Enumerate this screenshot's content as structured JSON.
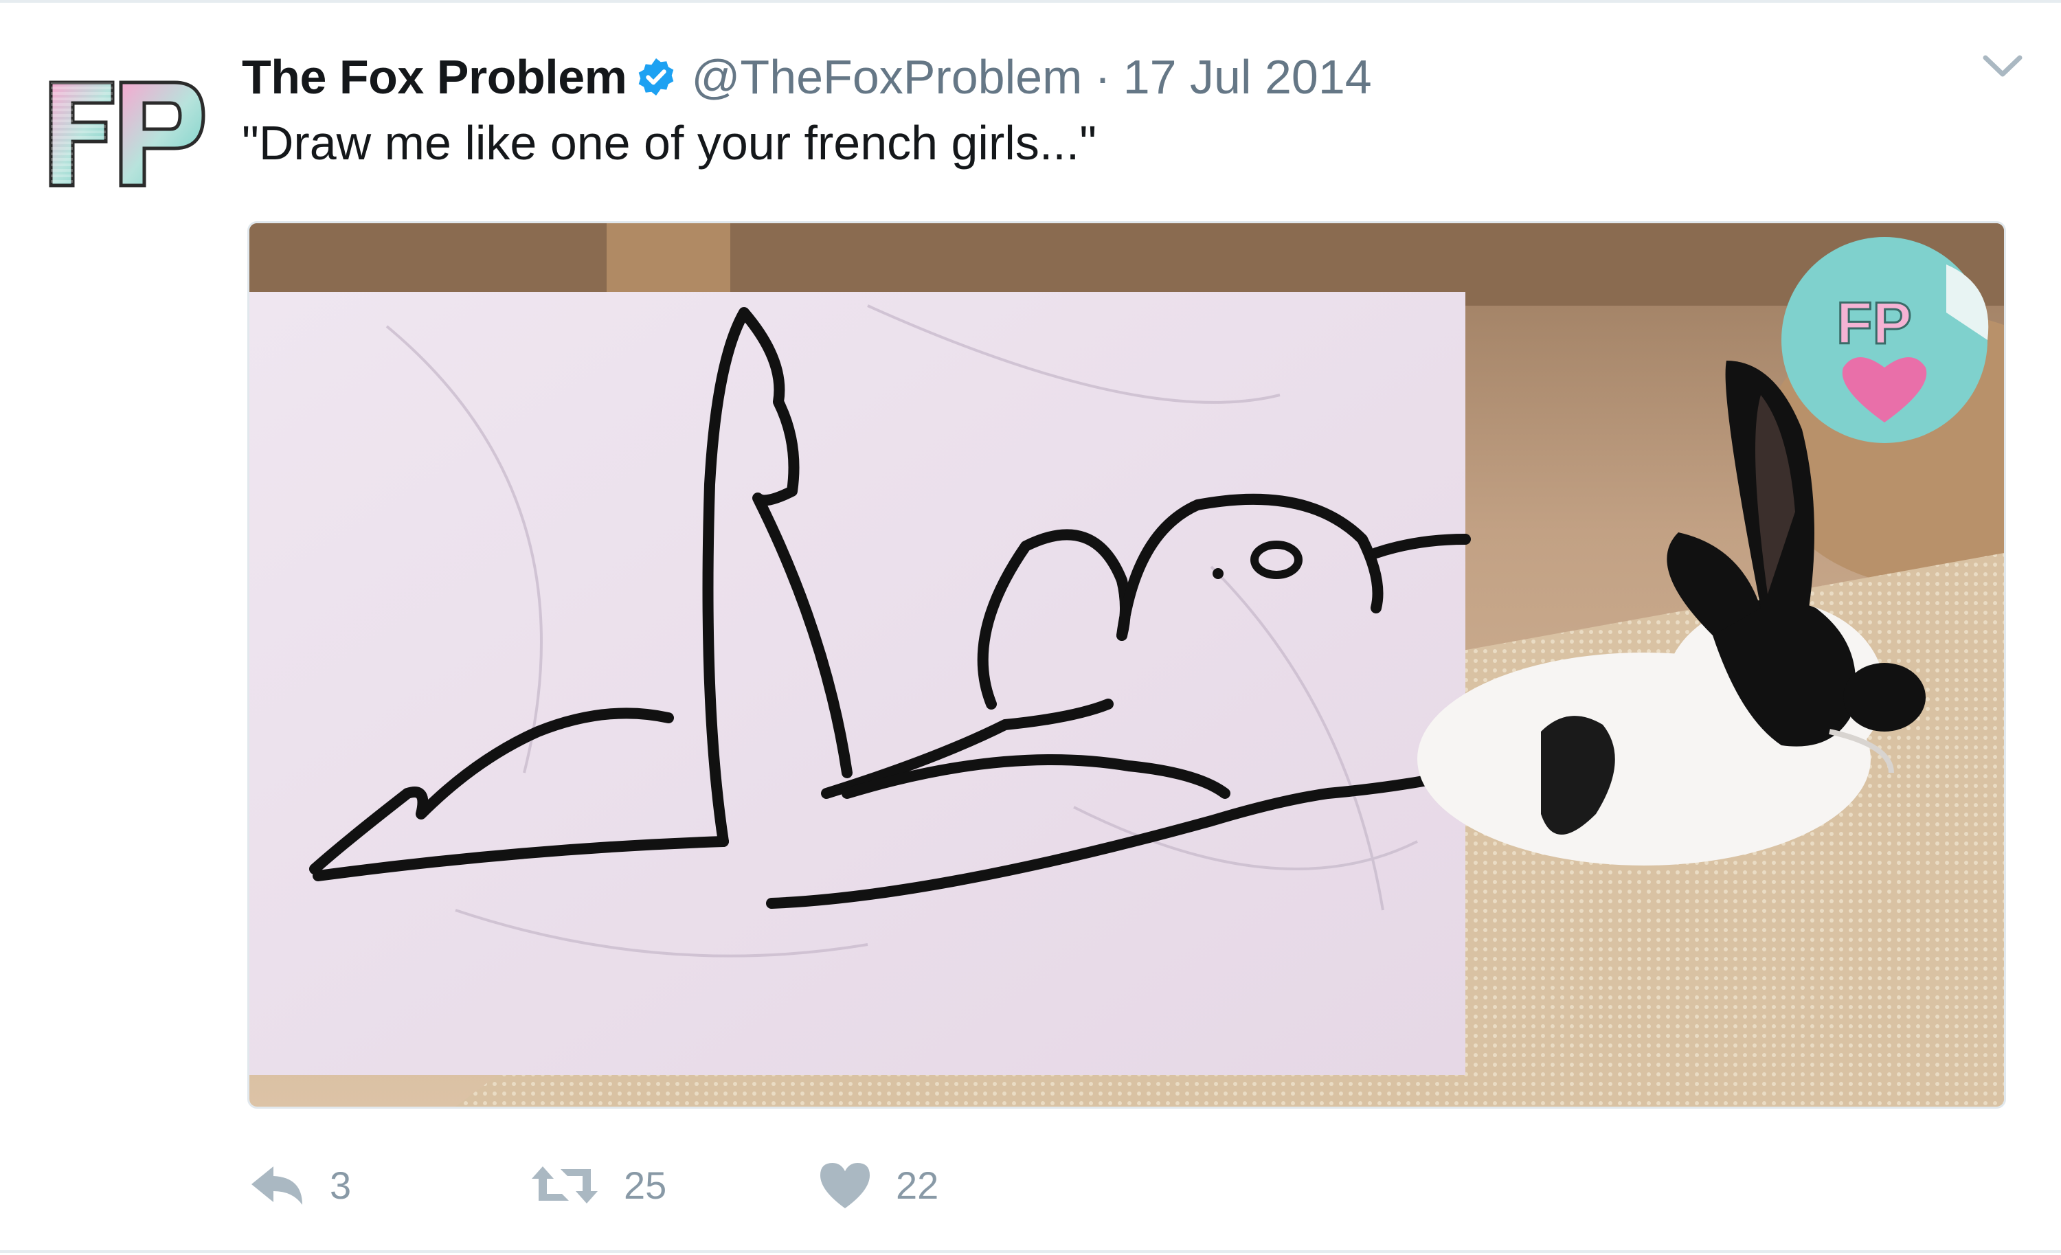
{
  "account": {
    "display_name": "The Fox Problem",
    "handle": "@TheFoxProblem",
    "separator": "·",
    "date": "17 Jul 2014",
    "avatar_text": "FP"
  },
  "tweet": {
    "text": "\"Draw me like one of your french girls...\""
  },
  "media": {
    "watermark_text": "FP"
  },
  "actions": {
    "reply_count": "3",
    "retweet_count": "25",
    "like_count": "22"
  },
  "icons": {
    "verified": "verified-badge-icon",
    "menu": "chevron-down-icon",
    "reply": "reply-icon",
    "retweet": "retweet-icon",
    "like": "heart-icon"
  },
  "colors": {
    "verified": "#1da1f2",
    "text": "#14171a",
    "secondary": "#657786",
    "action": "#8899a6",
    "avatar_pink": "#f4a6cf",
    "avatar_teal": "#6dd3c8"
  }
}
